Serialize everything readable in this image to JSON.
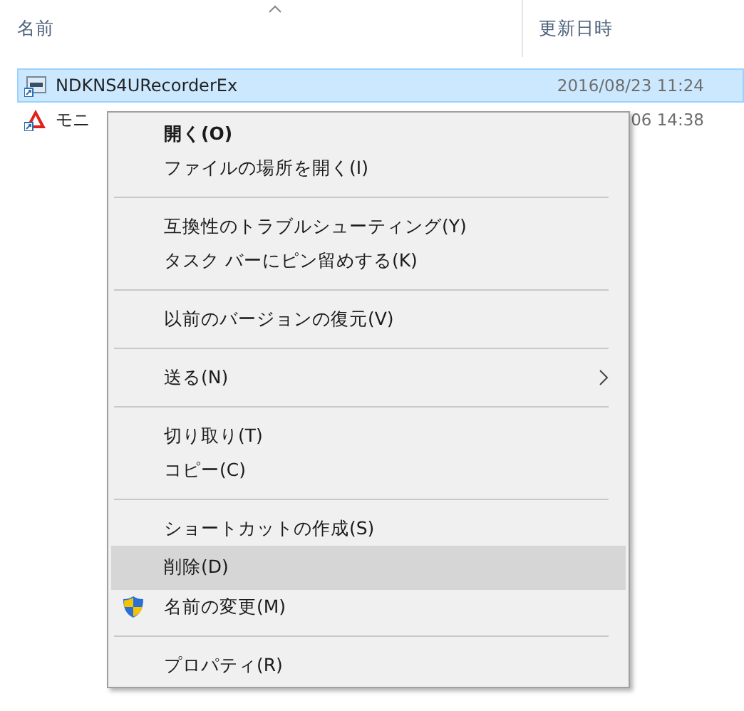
{
  "columns": [
    {
      "label": "名前",
      "sorted": true
    },
    {
      "label": "更新日時",
      "sorted": false
    }
  ],
  "files": [
    {
      "name": "NDKNS4URecorderEx",
      "modified": "2016/08/23 11:24",
      "selected": true,
      "kind": "app"
    },
    {
      "name": "モニ",
      "modified": "06 14:38",
      "selected": false,
      "kind": "pdf"
    }
  ],
  "context_menu": [
    {
      "kind": "item",
      "label": "開く(O)",
      "default": true,
      "selected": false
    },
    {
      "kind": "item",
      "label": "ファイルの場所を開く(I)",
      "default": false,
      "selected": false
    },
    {
      "kind": "separator"
    },
    {
      "kind": "item",
      "label": "互換性のトラブルシューティング(Y)",
      "default": false,
      "selected": false
    },
    {
      "kind": "item",
      "label": "タスク バーにピン留めする(K)",
      "default": false,
      "selected": false
    },
    {
      "kind": "separator"
    },
    {
      "kind": "item",
      "label": "以前のバージョンの復元(V)",
      "default": false,
      "selected": false
    },
    {
      "kind": "separator"
    },
    {
      "kind": "item",
      "label": "送る(N)",
      "default": false,
      "selected": false,
      "submenu": true
    },
    {
      "kind": "separator"
    },
    {
      "kind": "item",
      "label": "切り取り(T)",
      "default": false,
      "selected": false
    },
    {
      "kind": "item",
      "label": "コピー(C)",
      "default": false,
      "selected": false
    },
    {
      "kind": "separator"
    },
    {
      "kind": "item",
      "label": "ショートカットの作成(S)",
      "default": false,
      "selected": false
    },
    {
      "kind": "item",
      "label": "削除(D)",
      "default": false,
      "selected": true
    },
    {
      "kind": "item",
      "label": "名前の変更(M)",
      "default": false,
      "selected": false,
      "elevated": true
    },
    {
      "kind": "separator"
    },
    {
      "kind": "item",
      "label": "プロパティ(R)",
      "default": false,
      "selected": false
    }
  ]
}
